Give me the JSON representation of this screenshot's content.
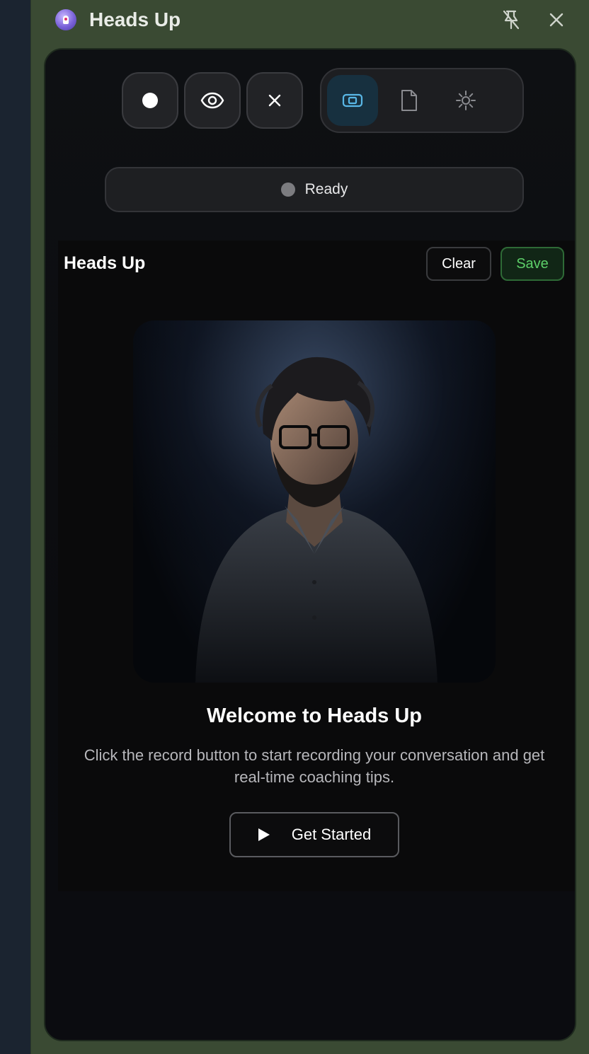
{
  "window": {
    "title": "Heads Up",
    "pin_icon": "pin-off-icon",
    "close_icon": "close-icon"
  },
  "toolbar": {
    "record_icon": "record-icon",
    "view_icon": "eye-icon",
    "dismiss_icon": "close-icon",
    "segments": [
      {
        "icon": "panel-icon",
        "active": true
      },
      {
        "icon": "document-icon",
        "active": false
      },
      {
        "icon": "settings-icon",
        "active": false
      }
    ]
  },
  "status": {
    "text": "Ready",
    "dot_color": "#7c7c80"
  },
  "content": {
    "title": "Heads Up",
    "clear_label": "Clear",
    "save_label": "Save",
    "welcome_title": "Welcome to Heads Up",
    "description": "Click the record button to start recording your conversation and get real-time coaching tips.",
    "start_label": "Get Started"
  },
  "colors": {
    "accent": "#5dcf69",
    "active_tab_icon": "#59b7e6",
    "frame": "#3a4a33"
  }
}
